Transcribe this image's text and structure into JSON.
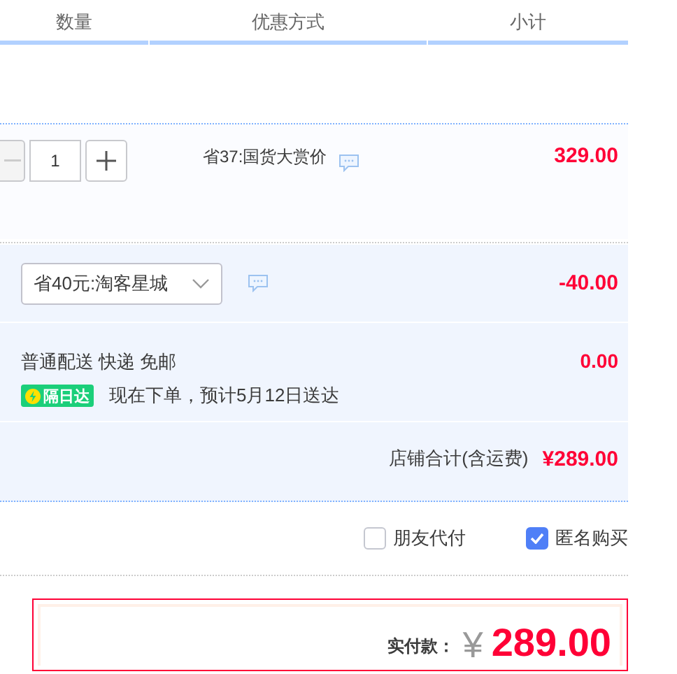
{
  "columns": [
    {
      "label": "数量"
    },
    {
      "label": "优惠方式"
    },
    {
      "label": "小计"
    }
  ],
  "item": {
    "quantity": "1",
    "minus_disabled": true,
    "promotion": "省37:国货大赏价",
    "subtotal": "329.00"
  },
  "shop_discount": {
    "selected_option": "省40元:淘客星城",
    "amount": "-40.00"
  },
  "delivery": {
    "method": "普通配送 快递 免邮",
    "badge": "隔日达",
    "estimate": "现在下单，预计5月12日送达",
    "fee": "0.00"
  },
  "shop_total": {
    "label": "店铺合计(含运费)",
    "amount": "¥289.00"
  },
  "options": [
    {
      "label": "朋友代付",
      "checked": false
    },
    {
      "label": "匿名购买",
      "checked": true
    }
  ],
  "payment": {
    "label": "实付款：",
    "currency": "¥",
    "amount": "289.00"
  }
}
